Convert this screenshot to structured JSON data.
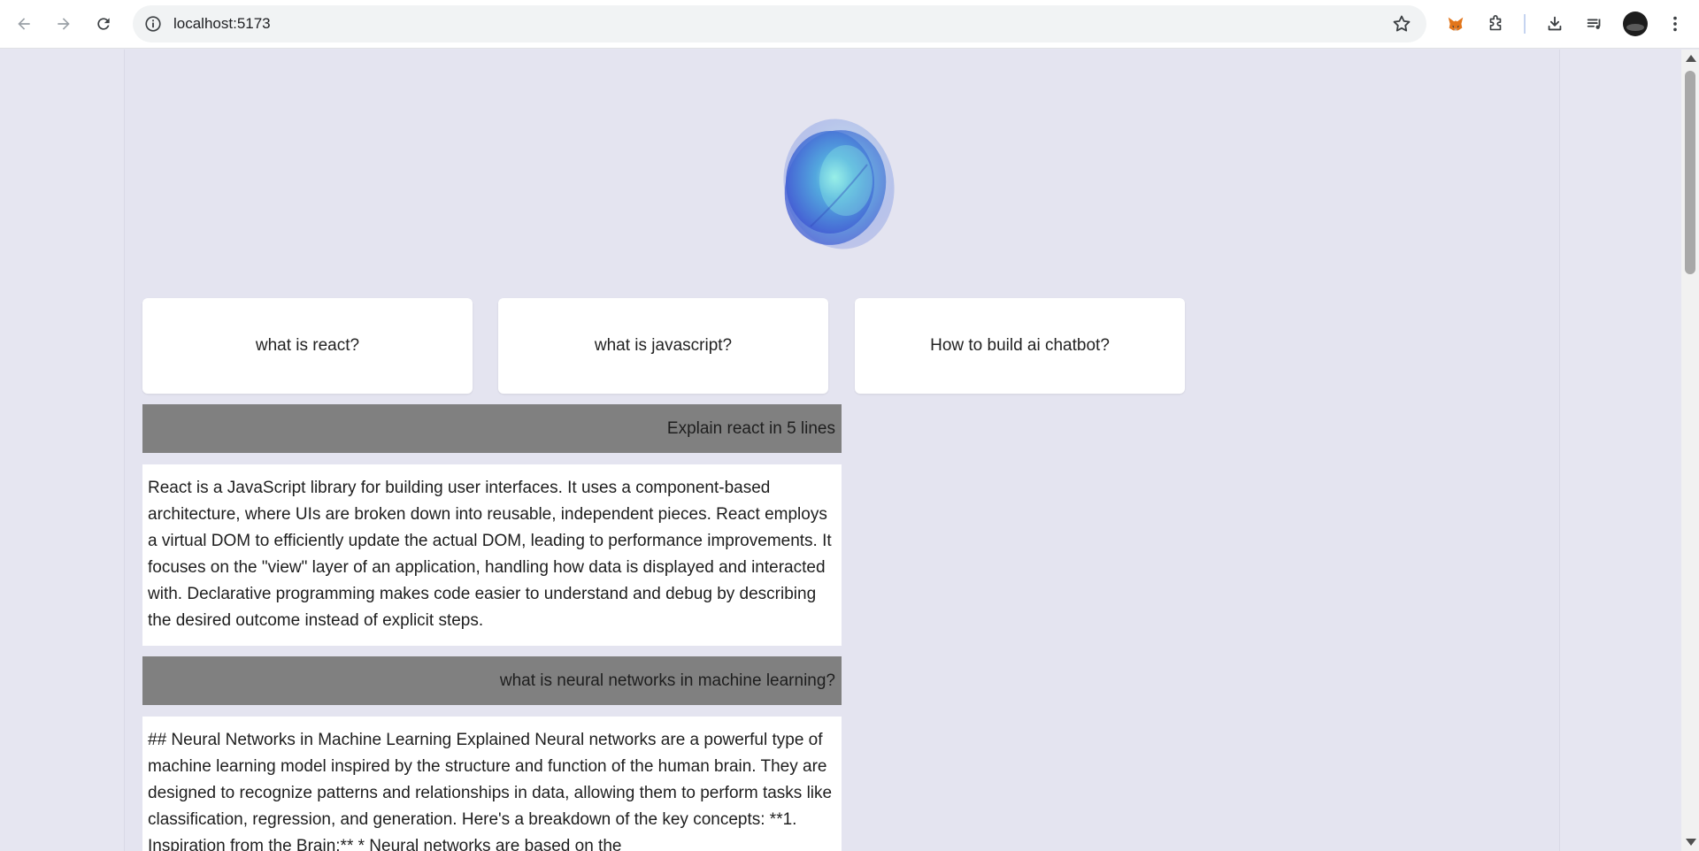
{
  "browser": {
    "url": "localhost:5173",
    "icons": {
      "back": "arrow-left-icon",
      "forward": "arrow-right-icon",
      "reload": "reload-icon",
      "site_info": "info-icon",
      "bookmark": "star-icon",
      "metamask": "fox-icon",
      "extensions": "puzzle-icon",
      "downloads": "download-icon",
      "media": "playlist-icon",
      "menu": "kebab-menu-icon"
    }
  },
  "app": {
    "accent_color": "#4a6cd8",
    "suggestions": [
      {
        "label": "what is react?"
      },
      {
        "label": "what is javascript?"
      },
      {
        "label": "How to build ai chatbot?"
      }
    ],
    "conversation": [
      {
        "role": "user",
        "text": "Explain react in 5 lines"
      },
      {
        "role": "assistant",
        "text": "React is a JavaScript library for building user interfaces. It uses a component-based architecture, where UIs are broken down into reusable, independent pieces. React employs a virtual DOM to efficiently update the actual DOM, leading to performance improvements. It focuses on the \"view\" layer of an application, handling how data is displayed and interacted with. Declarative programming makes code easier to understand and debug by describing the desired outcome instead of explicit steps."
      },
      {
        "role": "user",
        "text": "what is neural networks in machine learning?"
      },
      {
        "role": "assistant",
        "text": "## Neural Networks in Machine Learning Explained Neural networks are a powerful type of machine learning model inspired by the structure and function of the human brain. They are designed to recognize patterns and relationships in data, allowing them to perform tasks like classification, regression, and generation. Here's a breakdown of the key concepts: **1. Inspiration from the Brain:** * Neural networks are based on the"
      }
    ]
  }
}
